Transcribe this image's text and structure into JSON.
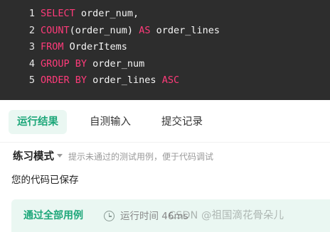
{
  "editor": {
    "lines": [
      {
        "num": "1",
        "tokens": [
          {
            "t": "SELECT",
            "k": true
          },
          {
            "t": " order_num,",
            "k": false
          }
        ]
      },
      {
        "num": "2",
        "tokens": [
          {
            "t": "COUNT",
            "k": true
          },
          {
            "t": "(order_num) ",
            "k": false
          },
          {
            "t": "AS",
            "k": true
          },
          {
            "t": " order_lines",
            "k": false
          }
        ]
      },
      {
        "num": "3",
        "tokens": [
          {
            "t": "FROM",
            "k": true
          },
          {
            "t": " OrderItems",
            "k": false
          }
        ]
      },
      {
        "num": "4",
        "tokens": [
          {
            "t": "GROUP BY",
            "k": true
          },
          {
            "t": " order_num",
            "k": false
          }
        ]
      },
      {
        "num": "5",
        "tokens": [
          {
            "t": "ORDER BY",
            "k": true
          },
          {
            "t": " order_lines ",
            "k": false
          },
          {
            "t": "ASC",
            "k": true
          }
        ]
      }
    ]
  },
  "tabs": {
    "run_result": "运行结果",
    "custom_input": "自测输入",
    "submit_history": "提交记录"
  },
  "mode": {
    "label": "练习模式",
    "hint": "提示未通过的测试用例，便于代码调试"
  },
  "status": {
    "saved": "您的代码已保存"
  },
  "result": {
    "pass_label": "通过全部用例",
    "runtime_label": "运行时间 46ms"
  },
  "watermark": "CSDN @祖国滴花骨朵儿",
  "colors": {
    "keyword": "#ff3b7a",
    "accent": "#1ea77a",
    "editor_bg": "#2d2d2d",
    "result_bg": "#eaf7f2"
  }
}
